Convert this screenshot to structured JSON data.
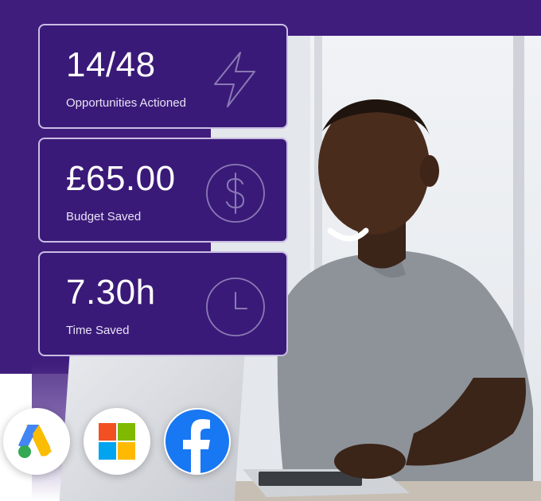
{
  "stats": [
    {
      "value": "14/48",
      "label": "Opportunities Actioned",
      "icon": "lightning-icon"
    },
    {
      "value": "£65.00",
      "label": "Budget Saved",
      "icon": "dollar-circle-icon"
    },
    {
      "value": "7.30h",
      "label": "Time Saved",
      "icon": "clock-icon"
    }
  ],
  "platforms": [
    {
      "name": "google-ads-logo",
      "icon": "google-ads-icon"
    },
    {
      "name": "microsoft-logo",
      "icon": "microsoft-icon"
    },
    {
      "name": "facebook-logo",
      "icon": "facebook-icon"
    }
  ],
  "colors": {
    "background": "#3f1d7c",
    "card": "#3a1a78",
    "card_border": "#c9bde3",
    "facebook": "#1877f2"
  }
}
